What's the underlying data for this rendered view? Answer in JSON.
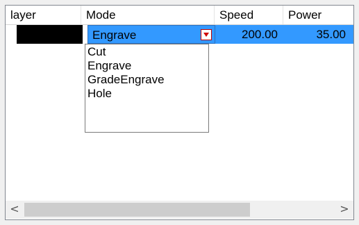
{
  "columns": {
    "layer": "layer",
    "mode": "Mode",
    "speed": "Speed",
    "power": "Power"
  },
  "row": {
    "mode": "Engrave",
    "speed": "200.00",
    "power": "35.00",
    "layer_color": "#000000"
  },
  "dropdown": {
    "options": [
      "Cut",
      "Engrave",
      "GradeEngrave",
      "Hole"
    ]
  },
  "scrollbar": {
    "left_arrow": "<",
    "right_arrow": ">"
  },
  "colors": {
    "selection": "#3399ff",
    "dropdown_button_arrow": "#d00000"
  }
}
